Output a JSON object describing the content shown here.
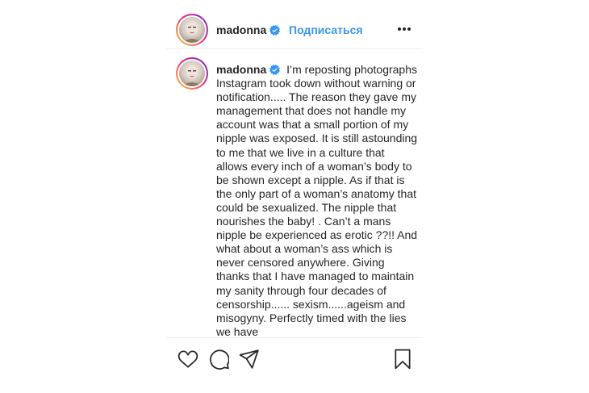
{
  "header": {
    "username": "madonna",
    "follow_label": "Подписаться",
    "verified_icon": "verified-badge-icon",
    "more_icon": "more-options-icon"
  },
  "comment": {
    "username": "madonna",
    "text": "I’m reposting photographs Instagram took down without warning or notification..... The reason they gave my management that does not handle my account was that a small portion of my nipple was exposed. It is still astounding to me that we live in a culture that allows every inch of a woman’s body to be shown except a nipple. As if that is the only part of a woman’s anatomy that could be sexualized. The nipple that nourishes the baby! . Can’t a mans nipple be experienced as erotic ??!! And what about a woman’s ass which is never censored anywhere. Giving thanks that I have managed to maintain my sanity through four decades of censorship...... sexism......ageism and misogyny. Perfectly timed with the lies we have"
  },
  "actions": {
    "icons": [
      "heart-icon",
      "comment-icon",
      "share-icon",
      "bookmark-icon"
    ]
  },
  "colors": {
    "link": "#3897f0",
    "text": "#262626",
    "verified": "#3897f0"
  }
}
